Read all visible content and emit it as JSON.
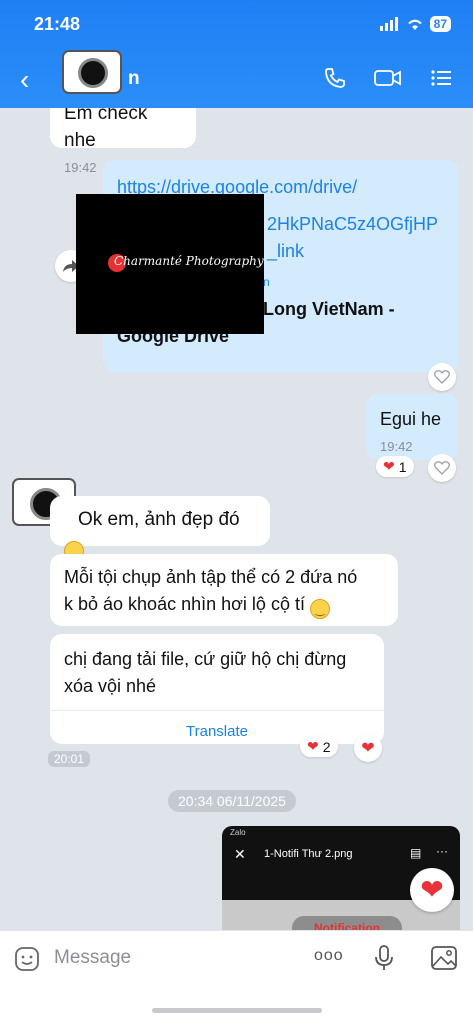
{
  "status": {
    "time": "21:48",
    "battery": "87"
  },
  "header": {
    "contact_suffix": "n"
  },
  "messages": {
    "m1_text": "Em check nhe",
    "m1_time": "19:42",
    "m2_link": "https://drive.google.com/drive/",
    "m2_link2": "2HkPNaC5z4OGfjHP",
    "m2_link3": "_link",
    "m2_link4": "n",
    "m2_title_line1": "Long VietNam  -",
    "m2_title_line2": "Google Drive",
    "m3_text": "Egui he",
    "m3_time": "19:42",
    "m3_reaction_count": "1",
    "m4_text": "Ok em, ảnh đẹp đó",
    "m5_line1": "Mỗi tội chụp ảnh tập thể có 2 đứa nó",
    "m5_line2": "k bỏ áo khoác nhìn hơi lộ cộ tí",
    "m6_line1": "chị đang tải file, cứ giữ hộ chị đừng",
    "m6_line2": "xóa vội nhé",
    "m6_translate": "Translate",
    "m6_reaction_count": "2",
    "m6_time": "20:01",
    "date_chip": "20:34 06/11/2025",
    "img_app": "Zalo",
    "img_filename": "1-Notifi Thư 2.png",
    "img_button": "Notification"
  },
  "watermark": {
    "brand": "Charmanté Photography"
  },
  "composer": {
    "placeholder": "Message",
    "more": "ooo"
  },
  "icons": [
    "back-icon",
    "phone-icon",
    "video-icon",
    "menu-icon",
    "heart-icon",
    "share-icon",
    "sticker-icon",
    "mic-icon",
    "image-icon"
  ],
  "colors": {
    "accent": "#2483f5",
    "outgoing": "#d4ebfd",
    "heart": "#e8323a"
  }
}
